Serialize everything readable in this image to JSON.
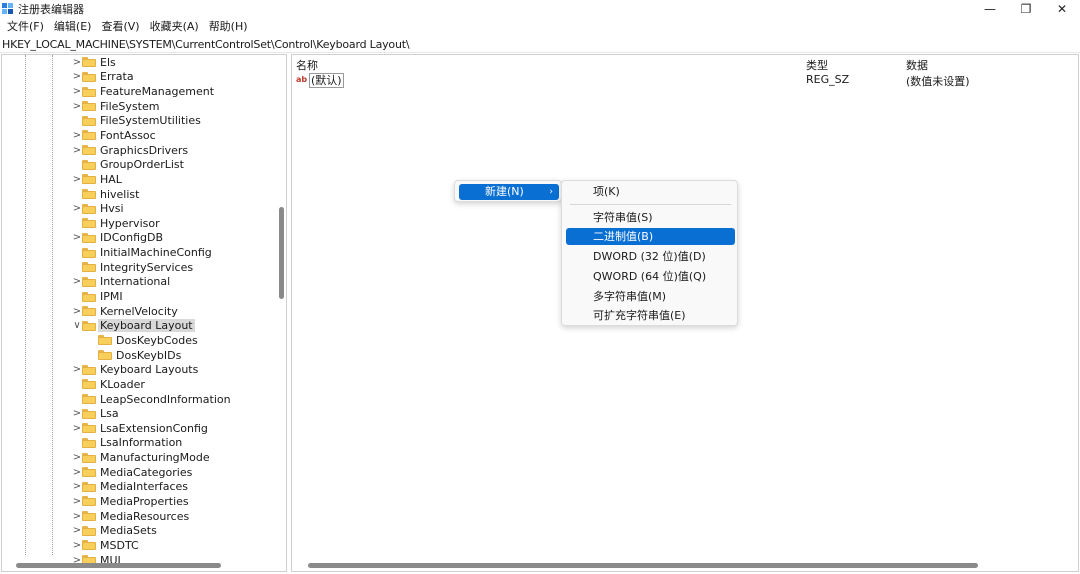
{
  "window": {
    "title": "注册表编辑器",
    "minimize": "—",
    "restore": "❐",
    "close": "✕"
  },
  "menubar": [
    {
      "label": "文件(F)"
    },
    {
      "label": "编辑(E)"
    },
    {
      "label": "查看(V)"
    },
    {
      "label": "收藏夹(A)"
    },
    {
      "label": "帮助(H)"
    }
  ],
  "address": "HKEY_LOCAL_MACHINE\\SYSTEM\\CurrentControlSet\\Control\\Keyboard Layout\\",
  "tree": {
    "items": [
      {
        "label": "Els",
        "chev": ">"
      },
      {
        "label": "Errata",
        "chev": ">"
      },
      {
        "label": "FeatureManagement",
        "chev": ">"
      },
      {
        "label": "FileSystem",
        "chev": ">"
      },
      {
        "label": "FileSystemUtilities",
        "chev": ""
      },
      {
        "label": "FontAssoc",
        "chev": ">"
      },
      {
        "label": "GraphicsDrivers",
        "chev": ">"
      },
      {
        "label": "GroupOrderList",
        "chev": ""
      },
      {
        "label": "HAL",
        "chev": ">"
      },
      {
        "label": "hivelist",
        "chev": ""
      },
      {
        "label": "Hvsi",
        "chev": ">"
      },
      {
        "label": "Hypervisor",
        "chev": ""
      },
      {
        "label": "IDConfigDB",
        "chev": ">"
      },
      {
        "label": "InitialMachineConfig",
        "chev": ""
      },
      {
        "label": "IntegrityServices",
        "chev": ""
      },
      {
        "label": "International",
        "chev": ">"
      },
      {
        "label": "IPMI",
        "chev": ""
      },
      {
        "label": "KernelVelocity",
        "chev": ">"
      },
      {
        "label": "Keyboard Layout",
        "chev": "∨",
        "selected": true
      },
      {
        "label": "DosKeybCodes",
        "chev": "",
        "child": true
      },
      {
        "label": "DosKeybIDs",
        "chev": "",
        "child": true
      },
      {
        "label": "Keyboard Layouts",
        "chev": ">"
      },
      {
        "label": "KLoader",
        "chev": ""
      },
      {
        "label": "LeapSecondInformation",
        "chev": ""
      },
      {
        "label": "Lsa",
        "chev": ">"
      },
      {
        "label": "LsaExtensionConfig",
        "chev": ">"
      },
      {
        "label": "LsaInformation",
        "chev": ""
      },
      {
        "label": "ManufacturingMode",
        "chev": ">"
      },
      {
        "label": "MediaCategories",
        "chev": ">"
      },
      {
        "label": "MediaInterfaces",
        "chev": ">"
      },
      {
        "label": "MediaProperties",
        "chev": ">"
      },
      {
        "label": "MediaResources",
        "chev": ">"
      },
      {
        "label": "MediaSets",
        "chev": ">"
      },
      {
        "label": "MSDTC",
        "chev": ">"
      },
      {
        "label": "MUI",
        "chev": ">"
      }
    ]
  },
  "values": {
    "columns": {
      "name": "名称",
      "type": "类型",
      "data": "数据"
    },
    "rows": [
      {
        "icon": "ab",
        "name": "(默认)",
        "type": "REG_SZ",
        "data": "(数值未设置)"
      }
    ]
  },
  "context_menu": {
    "new_label": "新建(N)",
    "arrow": "›",
    "submenu": [
      {
        "label": "项(K)"
      },
      {
        "label": "字符串值(S)"
      },
      {
        "label": "二进制值(B)",
        "highlighted": true
      },
      {
        "label": "DWORD (32 位)值(D)"
      },
      {
        "label": "QWORD (64 位)值(Q)"
      },
      {
        "label": "多字符串值(M)"
      },
      {
        "label": "可扩充字符串值(E)"
      }
    ]
  },
  "colors": {
    "accent": "#0a6fd2",
    "folder": "#f7cf5a",
    "selection": "#d9d9d9"
  }
}
